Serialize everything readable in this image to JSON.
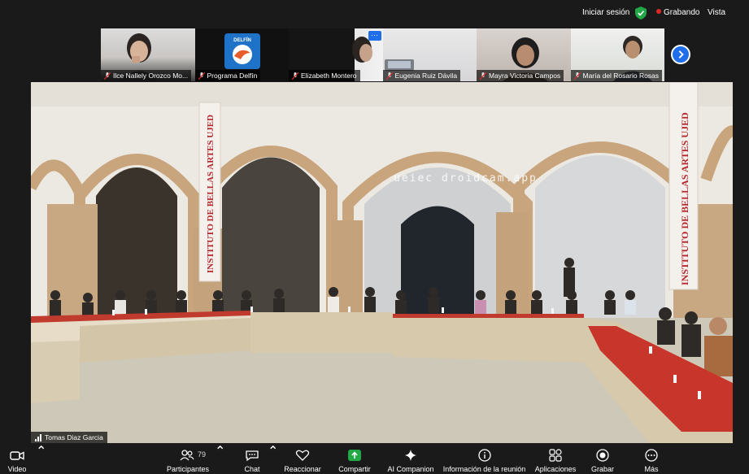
{
  "topbar": {
    "signin_label": "Iniciar sesión",
    "recording_label": "Grabando",
    "view_label": "Vista",
    "colors": {
      "recording_dot": "#e02828",
      "shield": "#22a846"
    }
  },
  "participants_strip": [
    {
      "name": "Ilce Nallely Orozco Mo...",
      "muted": true
    },
    {
      "name": "Programa Delfín",
      "muted": true,
      "logo_text": "DELFÍN"
    },
    {
      "name": "Elizabeth Montero",
      "muted": true
    },
    {
      "name": "Eugenia Ruiz Dávila",
      "muted": true
    },
    {
      "name": "Mayra Victoria Campos",
      "muted": true
    },
    {
      "name": "María del Rosario Rosas",
      "muted": true
    }
  ],
  "video": {
    "watermark": "ueiec droidcam.app",
    "banner_left": "INSTITUTO DE BELLAS ARTES UJED",
    "banner_right": "INSTITUTO DE BELLAS ARTES UJED",
    "speaker_name": "Tomas Diaz Garcia"
  },
  "toolbar": {
    "video_label": "Video",
    "participants_label": "Participantes",
    "participants_count": "79",
    "chat_label": "Chat",
    "react_label": "Reaccionar",
    "share_label": "Compartir",
    "ai_label": "AI Companion",
    "info_label": "Información de la reunión",
    "apps_label": "Aplicaciones",
    "record_label": "Grabar",
    "more_label": "Más",
    "colors": {
      "share": "#22a846",
      "accent": "#1f6feb"
    }
  }
}
